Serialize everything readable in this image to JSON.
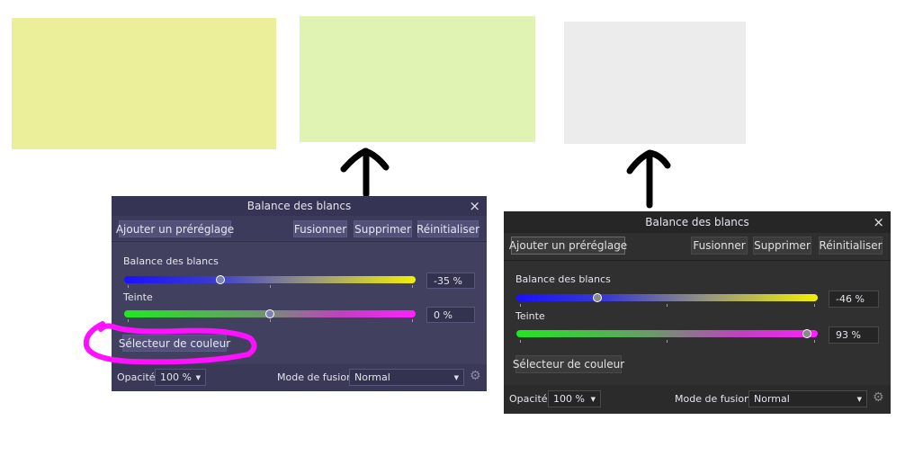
{
  "colors": {
    "swatch_yellow": "#ecef9a",
    "swatch_green": "#e0f3b3",
    "swatch_gray": "#ececec",
    "highlight": "#ff10ff",
    "arrow": "#000000"
  },
  "panel_left": {
    "title": "Balance des blancs",
    "close_icon": "×",
    "buttons": {
      "add_preset": "Ajouter un préréglage",
      "merge": "Fusionner",
      "delete": "Supprimer",
      "reset": "Réinitialiser"
    },
    "white_balance": {
      "label": "Balance des blancs",
      "value": "-35 %",
      "fraction": 0.33
    },
    "tint": {
      "label": "Teinte",
      "value": "0 %",
      "fraction": 0.5
    },
    "color_picker_button": "Sélecteur de couleur",
    "opacity": {
      "label": "Opacité:",
      "value": "100 %"
    },
    "blend_mode": {
      "label": "Mode de fusion:",
      "value": "Normal"
    },
    "gear_icon": "⚙",
    "caret_icon": "▼"
  },
  "panel_right": {
    "title": "Balance des blancs",
    "close_icon": "×",
    "buttons": {
      "add_preset": "Ajouter un préréglage",
      "merge": "Fusionner",
      "delete": "Supprimer",
      "reset": "Réinitialiser"
    },
    "white_balance": {
      "label": "Balance des blancs",
      "value": "-46 %",
      "fraction": 0.27
    },
    "tint": {
      "label": "Teinte",
      "value": "93 %",
      "fraction": 0.965
    },
    "color_picker_button": "Sélecteur de couleur",
    "opacity": {
      "label": "Opacité:",
      "value": "100 %"
    },
    "blend_mode": {
      "label": "Mode de fusion:",
      "value": "Normal"
    },
    "gear_icon": "⚙",
    "caret_icon": "▼"
  }
}
